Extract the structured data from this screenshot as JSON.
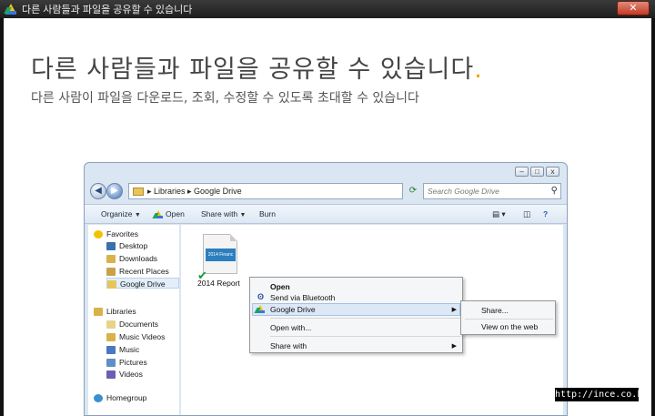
{
  "window": {
    "title": "다른 사람들과 파일을 공유할 수 있습니다",
    "close_label": "✕"
  },
  "main": {
    "headline": "다른 사람들과 파일을 공유할 수 있습니다",
    "headline_dot": ".",
    "subline": "다른 사람이 파일을 다운로드, 조회, 수정할 수 있도록 초대할 수 있습니다"
  },
  "explorer": {
    "address_path": "▸ Libraries ▸ Google Drive",
    "search_placeholder": "Search Google Drive",
    "toolbar": {
      "organize": "Organize",
      "open": "Open",
      "share_with": "Share with",
      "burn": "Burn"
    },
    "nav": {
      "favorites": "Favorites",
      "desktop": "Desktop",
      "downloads": "Downloads",
      "recent_places": "Recent Places",
      "google_drive": "Google Drive",
      "libraries": "Libraries",
      "documents": "Documents",
      "music_videos": "Music Videos",
      "music": "Music",
      "pictures": "Pictures",
      "videos": "Videos",
      "homegroup": "Homegroup"
    },
    "file": {
      "thumb_text": "2014 Financ",
      "label": "2014 Report"
    }
  },
  "context_menu": {
    "open": "Open",
    "send_bluetooth": "Send via Bluetooth",
    "google_drive": "Google Drive",
    "open_with": "Open with...",
    "share_with": "Share with",
    "bt_glyph": "ʘ"
  },
  "submenu": {
    "share": "Share...",
    "view_web": "View on the web"
  },
  "watermark": "http://ince.co.kr",
  "colors": {
    "accent_dot": "#f0a000",
    "drive_yellow": "#f4c20d",
    "drive_blue": "#3777e3",
    "drive_green": "#1da462"
  }
}
